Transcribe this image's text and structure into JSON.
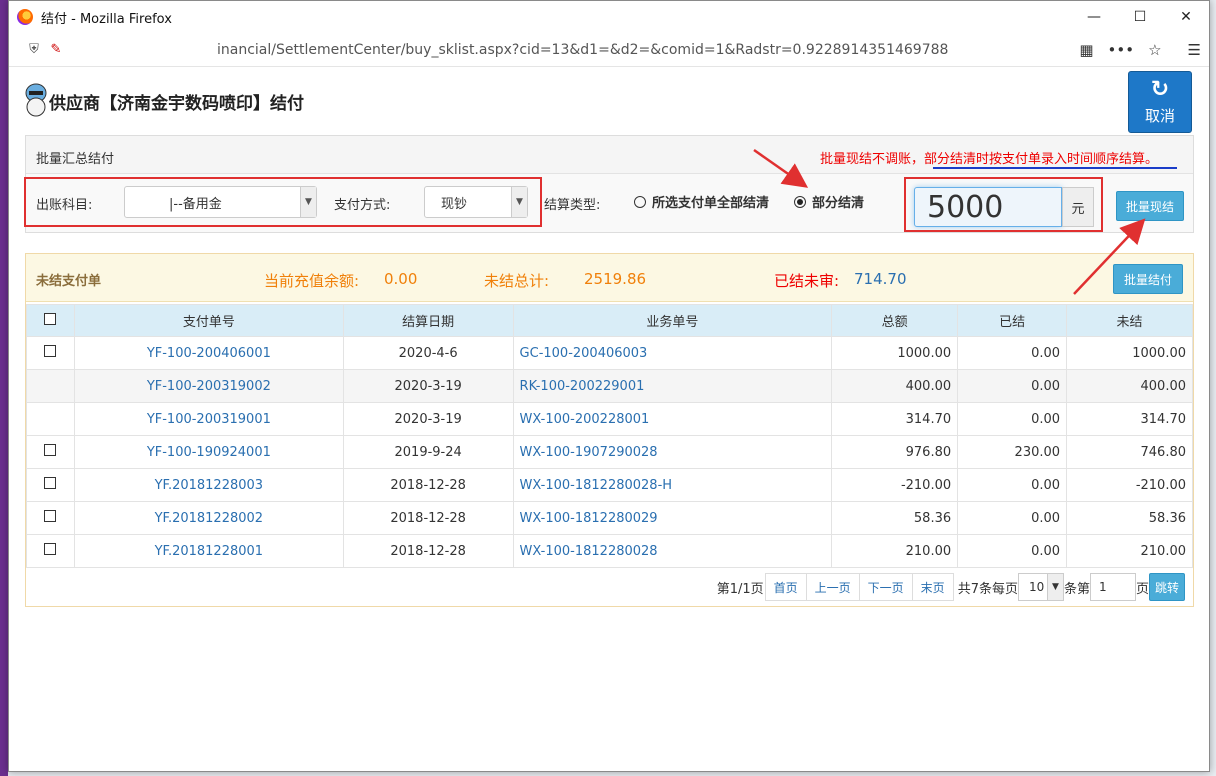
{
  "browser": {
    "window_title": "结付 - Mozilla Firefox",
    "url": "inancial/SettlementCenter/buy_sklist.aspx?cid=13&d1=&d2=&comid=1&Radstr=0.9228914351469788",
    "controls": {
      "minimize": "—",
      "maximize": "☐",
      "close": "✕"
    }
  },
  "page": {
    "title": "供应商【济南金宇数码喷印】结付",
    "cancel_label": "取消"
  },
  "batch_panel": {
    "heading": "批量汇总结付",
    "notice_prefix": "批量现结不调账，",
    "notice_rest": "部分结清时按支付单录入时间顺序结算。",
    "account_label": "出账科目:",
    "account_value": "|--备用金",
    "payment_label": "支付方式:",
    "payment_value": "现钞",
    "settle_type_label": "结算类型:",
    "option_all": "所选支付单全部结清",
    "option_partial": "部分结清",
    "amount": "5000",
    "unit": "元",
    "batch_cash_button": "批量现结"
  },
  "unsettled": {
    "heading": "未结支付单",
    "balance_label": "当前充值余额:",
    "balance_value": "0.00",
    "total_label": "未结总计:",
    "total_value": "2519.86",
    "unreviewed_label": "已结未审:",
    "unreviewed_value": "714.70",
    "batch_settle_button": "批量结付",
    "columns": [
      "支付单号",
      "结算日期",
      "业务单号",
      "总额",
      "已结",
      "未结"
    ],
    "rows": [
      {
        "checkbox": true,
        "pay_no": "YF-100-200406001",
        "date": "2020-4-6",
        "biz_no": "GC-100-200406003",
        "total": "1000.00",
        "settled": "0.00",
        "unsettled": "1000.00"
      },
      {
        "checkbox": false,
        "pay_no": "YF-100-200319002",
        "date": "2020-3-19",
        "biz_no": "RK-100-200229001",
        "total": "400.00",
        "settled": "0.00",
        "unsettled": "400.00"
      },
      {
        "checkbox": false,
        "pay_no": "YF-100-200319001",
        "date": "2020-3-19",
        "biz_no": "WX-100-200228001",
        "total": "314.70",
        "settled": "0.00",
        "unsettled": "314.70"
      },
      {
        "checkbox": true,
        "pay_no": "YF-100-190924001",
        "date": "2019-9-24",
        "biz_no": "WX-100-1907290028",
        "total": "976.80",
        "settled": "230.00",
        "unsettled": "746.80"
      },
      {
        "checkbox": true,
        "pay_no": "YF.20181228003",
        "date": "2018-12-28",
        "biz_no": "WX-100-1812280028-H",
        "total": "-210.00",
        "settled": "0.00",
        "unsettled": "-210.00"
      },
      {
        "checkbox": true,
        "pay_no": "YF.20181228002",
        "date": "2018-12-28",
        "biz_no": "WX-100-1812280029",
        "total": "58.36",
        "settled": "0.00",
        "unsettled": "58.36"
      },
      {
        "checkbox": true,
        "pay_no": "YF.20181228001",
        "date": "2018-12-28",
        "biz_no": "WX-100-1812280028",
        "total": "210.00",
        "settled": "0.00",
        "unsettled": "210.00"
      }
    ]
  },
  "pager": {
    "page_info": "第1/1页",
    "first": "首页",
    "prev": "上一页",
    "next": "下一页",
    "last": "末页",
    "count_text": "共7条每页",
    "page_size": "10",
    "per_page_suffix": "条第",
    "page_input": "1",
    "page_suffix": "页",
    "go": "跳转"
  },
  "colors": {
    "accent_blue": "#1e78c8",
    "button_blue": "#4aacd8",
    "highlight_red": "#e03030",
    "link_blue": "#2a6fb0"
  }
}
